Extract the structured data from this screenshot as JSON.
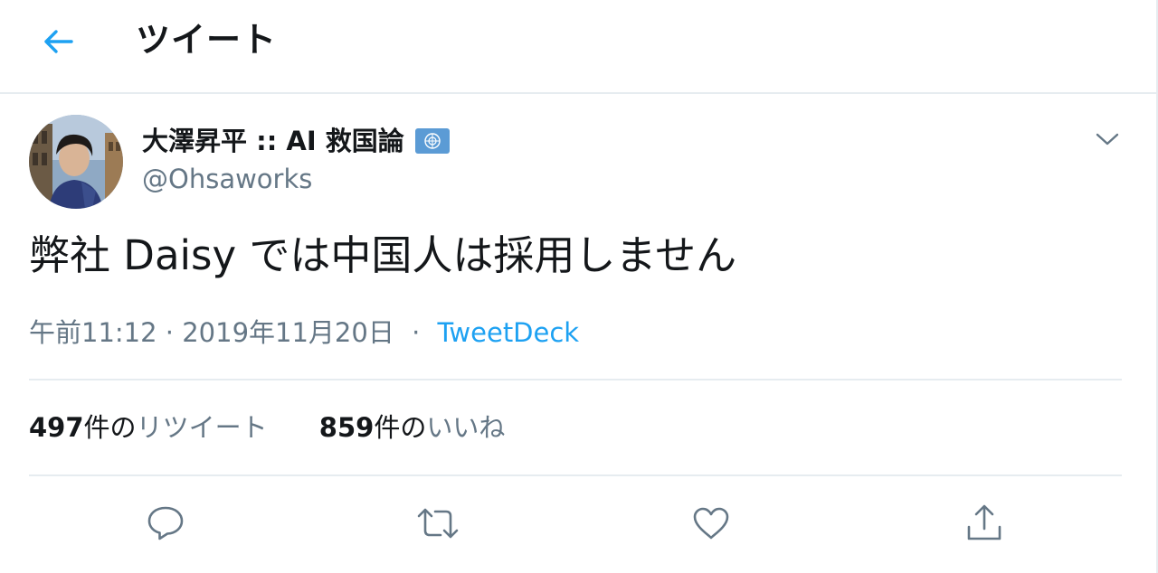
{
  "header": {
    "back_icon": "arrow-left-icon",
    "title": "ツイート"
  },
  "colors": {
    "accent": "#1da1f2",
    "secondary_text": "#657786",
    "border": "#e6ecf0",
    "badge": "#5b9bd5"
  },
  "tweet": {
    "author": {
      "display_name": "大澤昇平 :: AI 救国論",
      "handle": "@Ohsaworks",
      "badge_icon": "un-emblem-icon"
    },
    "text": "弊社 Daisy では中国人は採用しません",
    "time": "午前11:12 · 2019年11月20日",
    "separator": "·",
    "source": "TweetDeck",
    "retweets": {
      "count": "497",
      "suffix": "件の",
      "label": "リツイート"
    },
    "likes": {
      "count": "859",
      "suffix": "件の",
      "label": "いいね"
    },
    "actions": [
      "reply-icon",
      "retweet-icon",
      "like-icon",
      "share-icon"
    ]
  }
}
